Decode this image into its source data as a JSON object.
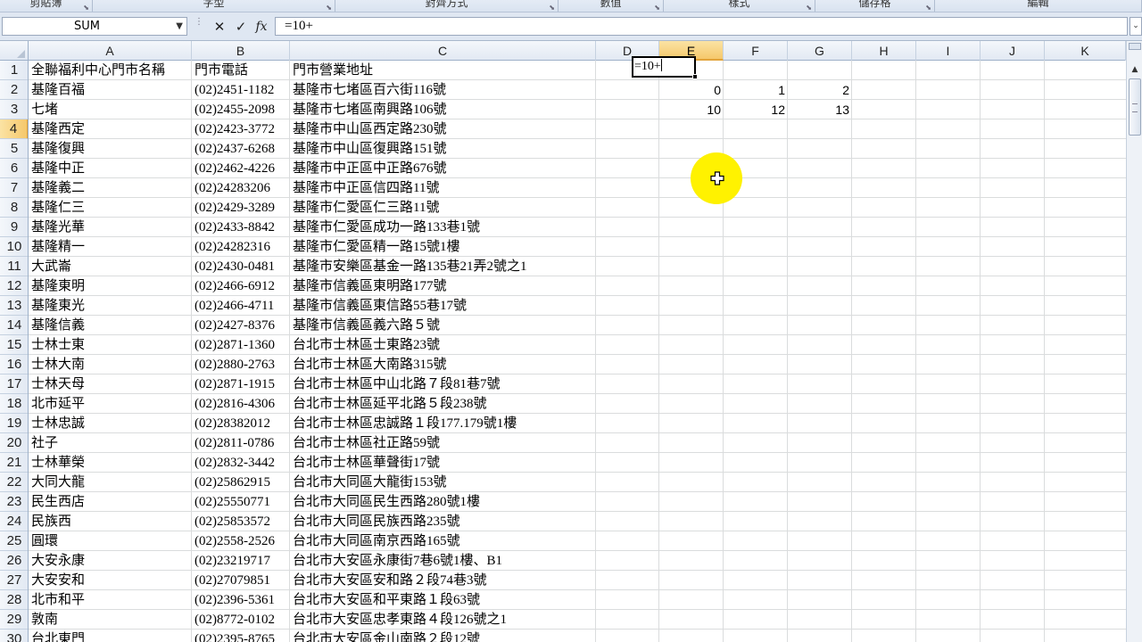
{
  "ribbon": {
    "groups": [
      {
        "label": "剪貼簿"
      },
      {
        "label": "字型"
      },
      {
        "label": "對齊方式"
      },
      {
        "label": "數值"
      },
      {
        "label": "樣式"
      },
      {
        "label": "儲存格"
      },
      {
        "label": "編輯"
      }
    ]
  },
  "formula_bar": {
    "name_box": "SUM",
    "cancel_icon": "✕",
    "enter_icon": "✓",
    "fx_label": "fx",
    "formula": "=10+"
  },
  "columns": [
    "A",
    "B",
    "C",
    "D",
    "E",
    "F",
    "G",
    "H",
    "I",
    "J",
    "K"
  ],
  "active_column": "E",
  "active_row": "4",
  "rows": [
    {
      "n": "1",
      "a": "全聯福利中心門市名稱",
      "b": "門市電話",
      "c": "門市營業地址"
    },
    {
      "n": "2",
      "a": "基隆百福",
      "b": "(02)2451-1182",
      "c": "基隆市七堵區百六街116號",
      "e": "0",
      "f": "1",
      "g": "2"
    },
    {
      "n": "3",
      "a": "七堵",
      "b": "(02)2455-2098",
      "c": "基隆市七堵區南興路106號",
      "e": "10",
      "f": "12",
      "g": "13"
    },
    {
      "n": "4",
      "a": "基隆西定",
      "b": "(02)2423-3772",
      "c": "基隆市中山區西定路230號",
      "e": "=10+"
    },
    {
      "n": "5",
      "a": "基隆復興",
      "b": "(02)2437-6268",
      "c": "基隆市中山區復興路151號"
    },
    {
      "n": "6",
      "a": "基隆中正",
      "b": "(02)2462-4226",
      "c": "基隆市中正區中正路676號"
    },
    {
      "n": "7",
      "a": "基隆義二",
      "b": "(02)24283206",
      "c": "基隆市中正區信四路11號"
    },
    {
      "n": "8",
      "a": "基隆仁三",
      "b": "(02)2429-3289",
      "c": "基隆市仁愛區仁三路11號"
    },
    {
      "n": "9",
      "a": "基隆光華",
      "b": "(02)2433-8842",
      "c": "基隆市仁愛區成功一路133巷1號"
    },
    {
      "n": "10",
      "a": "基隆精一",
      "b": "(02)24282316",
      "c": "基隆市仁愛區精一路15號1樓"
    },
    {
      "n": "11",
      "a": "大武崙",
      "b": "(02)2430-0481",
      "c": "基隆市安樂區基金一路135巷21弄2號之1"
    },
    {
      "n": "12",
      "a": "基隆東明",
      "b": "(02)2466-6912",
      "c": "基隆市信義區東明路177號"
    },
    {
      "n": "13",
      "a": "基隆東光",
      "b": "(02)2466-4711",
      "c": "基隆市信義區東信路55巷17號"
    },
    {
      "n": "14",
      "a": "基隆信義",
      "b": "(02)2427-8376",
      "c": "基隆市信義區義六路５號"
    },
    {
      "n": "15",
      "a": "士林士東",
      "b": "(02)2871-1360",
      "c": "台北市士林區士東路23號"
    },
    {
      "n": "16",
      "a": "士林大南",
      "b": "(02)2880-2763",
      "c": "台北市士林區大南路315號"
    },
    {
      "n": "17",
      "a": "士林天母",
      "b": "(02)2871-1915",
      "c": "台北市士林區中山北路７段81巷7號"
    },
    {
      "n": "18",
      "a": "北市延平",
      "b": "(02)2816-4306",
      "c": "台北市士林區延平北路５段238號"
    },
    {
      "n": "19",
      "a": "士林忠誠",
      "b": "(02)28382012",
      "c": "台北市士林區忠誠路１段177.179號1樓"
    },
    {
      "n": "20",
      "a": "社子",
      "b": "(02)2811-0786",
      "c": "台北市士林區社正路59號"
    },
    {
      "n": "21",
      "a": "士林華榮",
      "b": "(02)2832-3442",
      "c": "台北市士林區華聲街17號"
    },
    {
      "n": "22",
      "a": "大同大龍",
      "b": "(02)25862915",
      "c": "台北市大同區大龍街153號"
    },
    {
      "n": "23",
      "a": "民生西店",
      "b": "(02)25550771",
      "c": "台北市大同區民生西路280號1樓"
    },
    {
      "n": "24",
      "a": "民族西",
      "b": "(02)25853572",
      "c": "台北市大同區民族西路235號"
    },
    {
      "n": "25",
      "a": "圓環",
      "b": "(02)2558-2526",
      "c": "台北市大同區南京西路165號"
    },
    {
      "n": "26",
      "a": "大安永康",
      "b": "(02)23219717",
      "c": "台北市大安區永康街7巷6號1樓、B1"
    },
    {
      "n": "27",
      "a": "大安安和",
      "b": "(02)27079851",
      "c": "台北市大安區安和路２段74巷3號"
    },
    {
      "n": "28",
      "a": "北市和平",
      "b": "(02)2396-5361",
      "c": "台北市大安區和平東路１段63號"
    },
    {
      "n": "29",
      "a": "敦南",
      "b": "(02)8772-0102",
      "c": "台北市大安區忠孝東路４段126號之1"
    },
    {
      "n": "30",
      "a": "台北東門",
      "b": "(02)2395-8765",
      "c": "台北市大安區金山南路２段12號"
    }
  ]
}
